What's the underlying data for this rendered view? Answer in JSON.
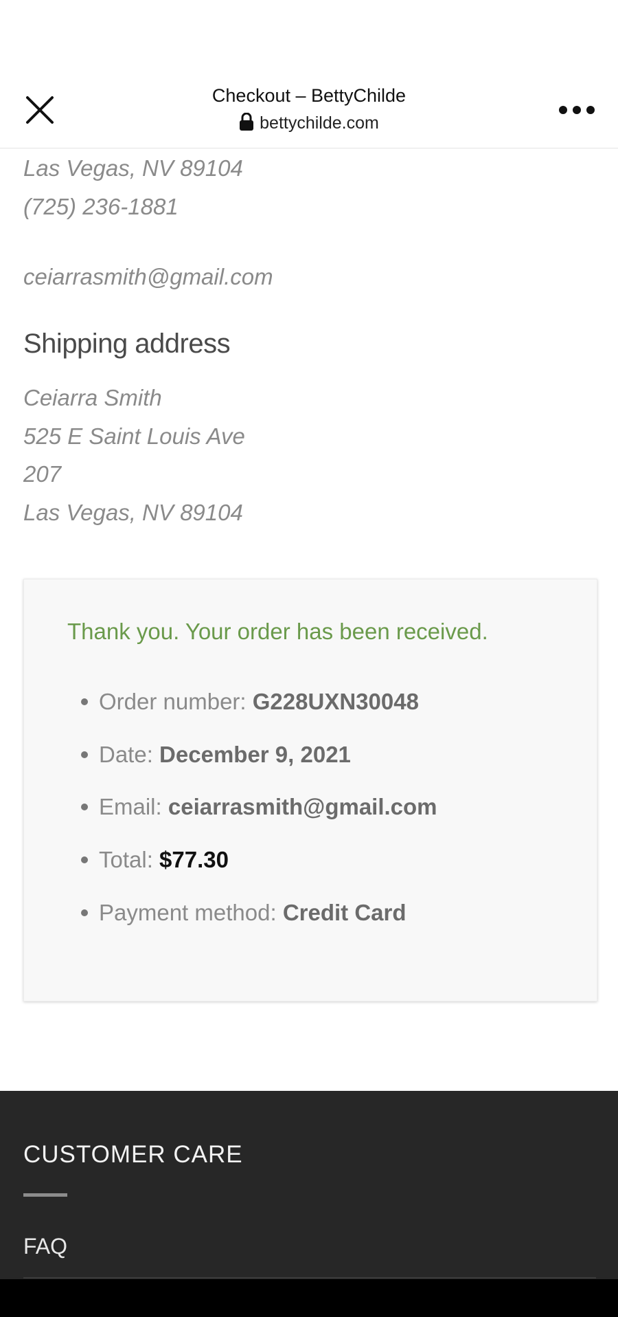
{
  "header": {
    "title": "Checkout – BettyChilde",
    "url": "bettychilde.com",
    "close_icon": "close-icon",
    "lock_icon": "lock-icon",
    "more_icon": "more-horizontal-icon"
  },
  "billing_partial": {
    "city_line": "Las Vegas, NV 89104",
    "phone": "(725) 236-1881",
    "email": "ceiarrasmith@gmail.com"
  },
  "shipping": {
    "heading": "Shipping address",
    "lines": [
      "Ceiarra Smith",
      "525 E Saint Louis Ave",
      "207",
      "Las Vegas, NV 89104"
    ]
  },
  "order": {
    "thank_you": "Thank you. Your order has been received.",
    "items": [
      {
        "label": "Order number:",
        "value": "G228UXN30048"
      },
      {
        "label": "Date:",
        "value": "December 9, 2021"
      },
      {
        "label": "Email:",
        "value": "ceiarrasmith@gmail.com"
      },
      {
        "label": "Total:",
        "value": "$77.30"
      },
      {
        "label": "Payment method:",
        "value": "Credit Card"
      }
    ]
  },
  "footer": {
    "heading": "CUSTOMER CARE",
    "links": [
      "FAQ"
    ]
  },
  "colors": {
    "success_green": "#6a9a4b",
    "footer_bg": "#272727",
    "box_bg": "#f8f8f8"
  }
}
